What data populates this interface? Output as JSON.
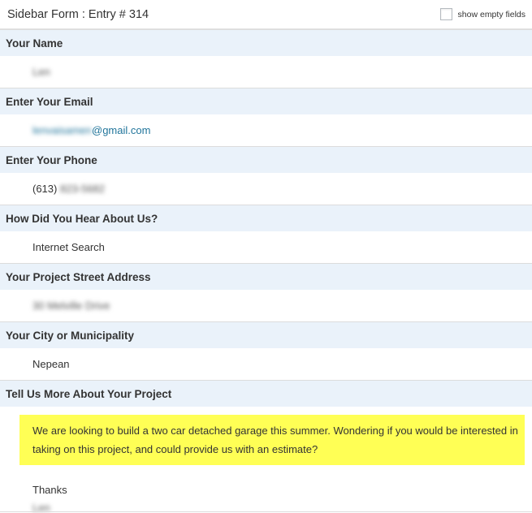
{
  "header": {
    "title": "Sidebar Form : Entry # 314",
    "show_empty_label": "show empty fields"
  },
  "fields": [
    {
      "label": "Your Name",
      "value": "Len"
    },
    {
      "label": "Enter Your Email",
      "value_blurred": "lenvaisamen",
      "value_visible": "@gmail.com"
    },
    {
      "label": "Enter Your Phone",
      "value_visible": "(613)",
      "value_blurred": "823-5682"
    },
    {
      "label": "How Did You Hear About Us?",
      "value": "Internet Search"
    },
    {
      "label": "Your Project Street Address",
      "value": "30 Melville Drive"
    },
    {
      "label": "Your City or Municipality",
      "value": "Nepean"
    },
    {
      "label": "Tell Us More About Your Project",
      "message_line1": "We are looking to build a two car detached garage this summer. Wondering if you would be interested in",
      "message_line2": "taking on this project, and could provide us with an estimate?",
      "closing": "Thanks",
      "signature": "Len"
    }
  ],
  "colors": {
    "label_background": "#eaf2fa",
    "highlight": "#ffff55",
    "link": "#21759b"
  }
}
